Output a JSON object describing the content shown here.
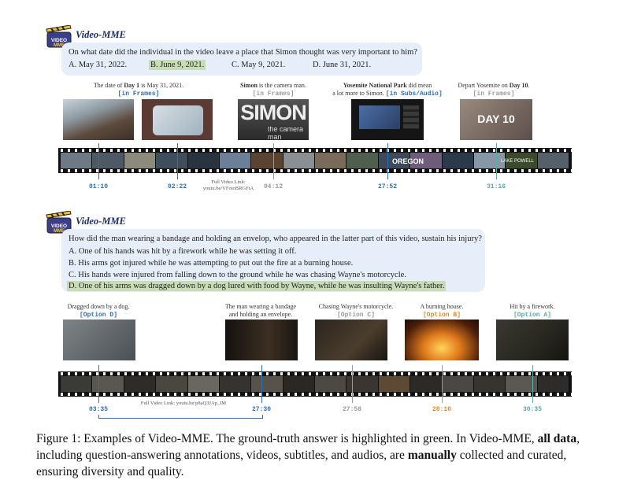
{
  "colors": {
    "blue": "#2d6fb0",
    "gray": "#9a9a9a",
    "green_hl": "#c8dcb6",
    "orange": "#d98b2b",
    "teal": "#5ea8a8"
  },
  "logo_icon": "clapperboard-icon",
  "example1": {
    "brand": "Video-MME",
    "question": "On what date did the individual in the video leave a place that Simon thought was very important to him?",
    "options": [
      "A. May 31, 2022.",
      "B. June 9, 2021.",
      "C. May 9, 2021.",
      "D. June 31, 2021."
    ],
    "answer_index": 1,
    "clues": [
      {
        "pre": "The date of ",
        "bold": "Day 1",
        "post": " is May 31, 2021.",
        "line2": "",
        "tag": "[in Frames]",
        "color": "blue",
        "time": "01:10"
      },
      {
        "pre": "",
        "bold": "",
        "post": "",
        "line2": "",
        "tag": "",
        "color": "blue",
        "time": "02:22"
      },
      {
        "pre": "",
        "bold": "Simon",
        "post": " is the camera man.",
        "line2": "",
        "tag": "[in Frames]",
        "color": "gray",
        "time": "04:12"
      },
      {
        "pre": "",
        "bold": "Yosemite National Park",
        "post": " did mean",
        "line2": "a lot more to Simon. ",
        "tag": "[in Subs/Audio]",
        "color": "blue",
        "time": "27:52"
      },
      {
        "pre": "Depart Yosemite on ",
        "bold": "Day 10",
        "post": ".",
        "line2": "",
        "tag": "[in Frames]",
        "color": "gray",
        "time": "31:16"
      }
    ],
    "thumb_texts": [
      "SIMON",
      "the camera man",
      "DAY 10"
    ],
    "strip_texts": [
      "OREGON",
      "LAKE POWELL"
    ],
    "link_label": "Full Video Link:",
    "link_url": "youtu.be/VFotoBRGFtA"
  },
  "example2": {
    "brand": "Video-MME",
    "question": "How did the man wearing a bandage and holding an envelop, who appeared in the latter part of this video, sustain his injury?",
    "options": [
      "A. One of his hands was hit by a firework while he was setting it off.",
      "B. His arms got injured while he was attempting to put out the fire at a burning house.",
      "C. His hands were injured from falling down to the ground while he was chasing Wayne's motorcycle.",
      "D. One of his arms was dragged down by a dog lured with food by Wayne, while he was insulting Wayne's father."
    ],
    "answer_index": 3,
    "clues": [
      {
        "line1": "Dragged down by a dog.",
        "line2": "",
        "tag": "[Option D]",
        "color": "blue",
        "time": "03:35"
      },
      {
        "line1": "The man wearing a bandage",
        "line2": "and holding an envelope.",
        "tag": "",
        "color": "blue",
        "time": "27:30"
      },
      {
        "line1": "Chasing Wayne's motorcycle.",
        "line2": "",
        "tag": "[Option C]",
        "color": "gray",
        "time": "27:58"
      },
      {
        "line1": "A burning house.",
        "line2": "",
        "tag": "[Option B]",
        "color": "orange",
        "time": "28:10"
      },
      {
        "line1": "Hit by a firework.",
        "line2": "",
        "tag": "[Option A]",
        "color": "teal",
        "time": "30:35"
      }
    ],
    "link_label": "Full Video Link: youtu.be/p8aQ3JAp_IM"
  },
  "caption": {
    "p1": "Figure 1: Examples of Video-MME. The ground-truth answer is highlighted in green.  In Video-MME, ",
    "b1": "all data",
    "p2": ", including question-answering annotations, videos, subtitles, and audios, are ",
    "b2": "manually",
    "p3": " collected and curated, ensuring diversity and quality."
  }
}
